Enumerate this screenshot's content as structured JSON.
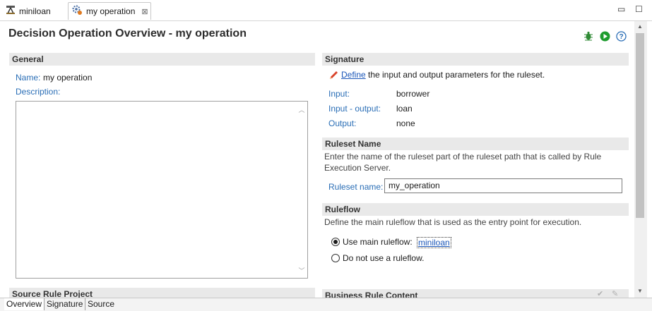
{
  "tabs": [
    {
      "label": "miniloan",
      "icon": "ruleflow-icon"
    },
    {
      "label": "my operation",
      "icon": "decision-operation-icon",
      "close": "⊠"
    }
  ],
  "window_controls": {
    "minimize": "▭",
    "maximize": "☐"
  },
  "editor": {
    "title": "Decision Operation Overview - my operation",
    "actions": [
      "debug-icon",
      "run-icon",
      "help-icon"
    ]
  },
  "general": {
    "header": "General",
    "name_label": "Name:",
    "name_value": "my operation",
    "description_label": "Description:",
    "description_value": ""
  },
  "signature": {
    "header": "Signature",
    "define_link": "Define",
    "define_text": "the input and output parameters for the ruleset.",
    "input_label": "Input:",
    "input_value": "borrower",
    "inout_label": "Input - output:",
    "inout_value": "loan",
    "output_label": "Output:",
    "output_value": "none"
  },
  "ruleset": {
    "header": "Ruleset Name",
    "description_line1": "Enter the name of the ruleset part of the ruleset path that is called by Rule",
    "description_line2": "Execution Server.",
    "field_label": "Ruleset name:",
    "field_value": "my_operation"
  },
  "ruleflow": {
    "header": "Ruleflow",
    "description": "Define the main ruleflow that is used as the entry point for execution.",
    "option_main": "Use main ruleflow:",
    "main_link": "miniloan",
    "option_none": "Do not use a ruleflow.",
    "selected": "main"
  },
  "partial_sections": {
    "source_rule_project": "Source Rule Project",
    "business_rule_content": "Business Rule Content"
  },
  "bottom_tabs": [
    "Overview",
    "Signature",
    "Source"
  ],
  "colors": {
    "label_blue": "#2a6eb6",
    "link_blue": "#1b56b8",
    "section_bg": "#e9e9e9",
    "run_green": "#1e9c2e"
  }
}
